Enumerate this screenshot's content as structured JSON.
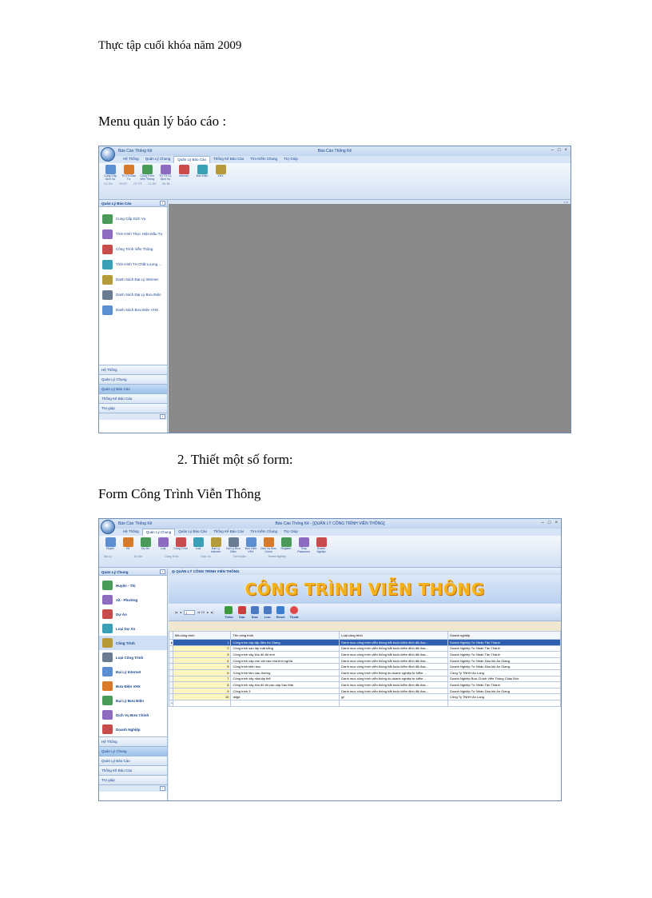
{
  "document": {
    "header": "Thực tập cuối khóa năm 2009",
    "heading_menu": "Menu quản lý báo cáo :",
    "heading_design": "2.  Thiết một số form:",
    "heading_form": "Form Công Trình Viễn Thông"
  },
  "colors": {
    "ribbon_blue": "#15428b",
    "workspace_gray": "#8a8a8a",
    "banner_orange": "#f6b21c",
    "selected_row": "#2e5fb1"
  },
  "shot1": {
    "qat": "Báo Cáo Thống Kê",
    "window_title": "Báo Cáo Thống Kê",
    "tabs": [
      "Hệ Thống",
      "Quản Lý Chung",
      "Quản Lý Báo Cáo",
      "Thống Kê Báo Cáo",
      "Tìm Kiếm Chung",
      "Trợ Giúp"
    ],
    "ribbon_buttons": [
      "Cung Cấp Dịch Vụ",
      "TH TH Đầu Tư",
      "Công Trình Viễn Thông",
      "TH TH CL Dịch Vụ",
      "Internet",
      "Bưu Điện",
      "VHX"
    ],
    "ribbon_groups": [
      "CC DV",
      "TH ĐT",
      "CT VT",
      "CL DV",
      "ĐL ĐL"
    ],
    "nav_header": "Quản Lý Báo Cáo",
    "nav_items": [
      "Cung Cấp Dịch Vụ",
      "Tình Hình Thực Hiện Đầu Tư",
      "Công Trình Viễn Thông",
      "Tình Hình TH Chất Lượng ...",
      "Danh Sách Đại Lý Internet",
      "Danh Sách Đại Lý Bưu Điện",
      "Danh Sách Bưu Điện VHX"
    ],
    "nav_categories": [
      "Hệ Thống",
      "Quản Lý Chung",
      "Quản Lý Báo Cáo",
      "Thống Kê Báo Cáo",
      "Trợ giúp"
    ],
    "nav_active": "Quản Lý Báo Cáo"
  },
  "shot2": {
    "qat": "Báo Cáo Thống Kê",
    "window_title": "Báo Cáo Thống Kê - [QUẢN LÝ CÔNG TRÌNH VIỄN THÔNG]",
    "tabs": [
      "Hệ Thống",
      "Quản Lý Chung",
      "Quản Lý Báo Cáo",
      "Thống Kê Báo Cáo",
      "Tìm Kiếm Chung",
      "Trợ Giúp"
    ],
    "ribbon_buttons": [
      "Huyện",
      "Xã",
      "Dự Án",
      "Loại",
      "Công Trình",
      "Loại",
      "Đại Lý Internet",
      "Đại Lý Bưu Điện",
      "Bưu Điện VHX",
      "Dịch Vụ Bưu Chính",
      "Register",
      "Thay Password",
      "Doanh Nghiệp"
    ],
    "ribbon_groups": [
      "Địa Lý",
      "Dự Án",
      "Công Trình",
      "Dịch Vụ",
      "Tài Khoản",
      "Doanh Nghiệp"
    ],
    "nav_header": "Quản Lý Chung",
    "nav_items": [
      "Huyện - Thị",
      "Xã - Phường",
      "Dự Án",
      "Loại Dự Án",
      "Công Trình",
      "Loại Công Trình",
      "Đại Lý Internet",
      "Bưu Điện VHX",
      "Đại Lý Bưu Điện",
      "Dịch Vụ Bưu Chính",
      "Doanh Nghiệp"
    ],
    "nav_categories": [
      "Hệ Thống",
      "Quản Lý Chung",
      "Quản Lý Báo Cáo",
      "Thống Kê Báo Cáo",
      "Trợ giúp"
    ],
    "nav_active": "Quản Lý Chung",
    "form_title": "QUẢN LÝ CÔNG TRÌNH VIỄN THÔNG",
    "banner": "CÔNG TRÌNH VIỄN THÔNG",
    "pager": {
      "position": "1",
      "of": "of 10"
    },
    "toolbar_buttons": [
      "Thêm",
      "Xóa",
      "Sửa",
      "Lưu",
      "Reset",
      "Thoát"
    ],
    "grid_headers": [
      "Mã công trình",
      "Tên công trình",
      "Loại công trình",
      "Doanh nghiệp"
    ],
    "rows": [
      {
        "id": "1",
        "name": "Công trình cấp tập điện An Giang",
        "type": "Danh mục công trình viễn thông bắt buộc kiểm định đã đưa...",
        "company": "Doanh Nghiệp Tư Nhân Tân Thành"
      },
      {
        "id": "2",
        "name": "Công trình san lấp mặt bằng",
        "type": "Danh mục công trình viễn thông bắt buộc kiểm định đã đưa...",
        "company": "Doanh Nghiệp Tư Nhân Tân Thành"
      },
      {
        "id": "3",
        "name": "Công trình xây khu đô thị mới",
        "type": "Danh mục công trình viễn thông bắt buộc kiểm định đã đưa...",
        "company": "Doanh Nghiệp Tư Nhân Tân Thành"
      },
      {
        "id": "4",
        "name": "Công trình cấp vốn vật vào nhà tình nghĩa",
        "type": "Danh mục công trình viễn thông bắt buộc kiểm định đã đưa...",
        "company": "Doanh Nghiệp Tư Nhân Dầu khí An Giang"
      },
      {
        "id": "5",
        "name": "Công trình kiến trúc",
        "type": "Danh mục công trình viễn thông bắt buộc kiểm định đã đưa...",
        "company": "Doanh Nghiệp Tư Nhân Dầu khí An Giang"
      },
      {
        "id": "6",
        "name": "Công trình làm cầu đường",
        "type": "Danh mục công trình viễn thông do doanh nghiệp tự kiểm ...",
        "company": "Công Ty TNHH An Long"
      },
      {
        "id": "7",
        "name": "Công trình xây nhà tập thể",
        "type": "Danh mục công trình viễn thông do doanh nghiệp tự kiểm ...",
        "company": "Doanh Nghiệp Bưu Chính Viễn Thông Châu Đốc"
      },
      {
        "id": "8",
        "name": "Công trình xây khu đô thị cao cấp Sao Mai",
        "type": "Danh mục công trình viễn thông bắt buộc kiểm định đã đưa...",
        "company": "Doanh Nghiệp Tư Nhân Tân Thành"
      },
      {
        "id": "9",
        "name": "Công trình 3",
        "type": "Danh mục công trình viễn thông bắt buộc kiểm định đã đưa...",
        "company": "Doanh Nghiệp Tư Nhân Dầu khí An Giang"
      },
      {
        "id": "10",
        "name": "ddgd",
        "type": "gf",
        "company": "Công Ty TNHH An Long"
      }
    ],
    "current_row": 0
  }
}
